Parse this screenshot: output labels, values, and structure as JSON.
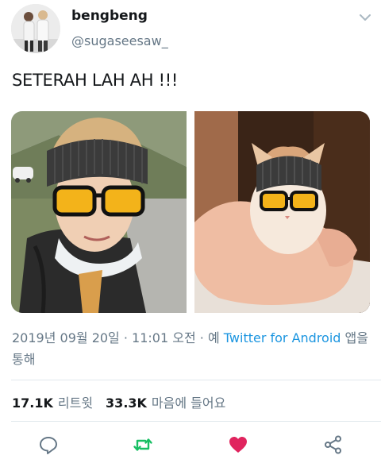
{
  "user": {
    "display_name": "bengbeng",
    "handle": "@sugaseesaw_"
  },
  "tweet": {
    "text": "SETERAH LAH AH !!!",
    "date": "2019년 09월 20일",
    "time": "11:01 오전",
    "via_prefix": "예",
    "source": "Twitter for Android",
    "via_suffix": "앱을",
    "via_suffix_line2": "통해"
  },
  "stats": {
    "retweets_count": "17.1K",
    "retweets_label": "리트윗",
    "likes_count": "33.3K",
    "likes_label": "마음에 들어요"
  },
  "icons": {
    "more": "chevron-down-icon",
    "reply": "reply-icon",
    "retweet": "retweet-icon",
    "like": "heart-icon",
    "share": "share-icon"
  },
  "colors": {
    "retweet_active": "#17bf63",
    "like_active": "#e0245e",
    "link": "#1b95e0",
    "secondary_text": "#657786"
  }
}
